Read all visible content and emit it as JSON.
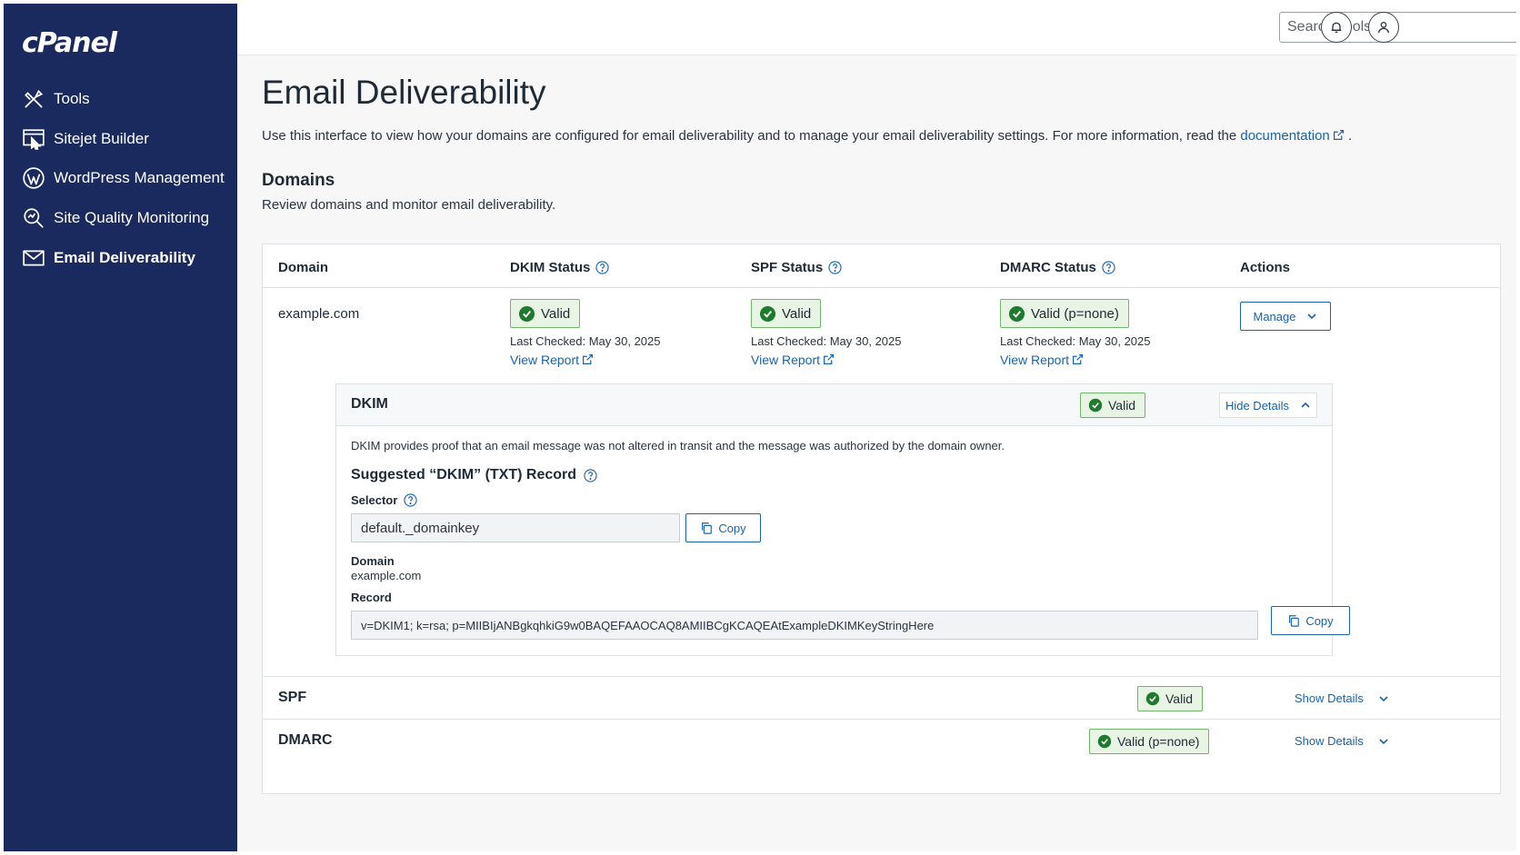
{
  "brand": {
    "logo_text": "cPanel"
  },
  "sidebar": {
    "items": [
      {
        "label": "Tools",
        "icon": "tools-icon"
      },
      {
        "label": "Sitejet Builder",
        "icon": "sitejet-icon"
      },
      {
        "label": "WordPress Management",
        "icon": "wordpress-icon"
      },
      {
        "label": "Site Quality Monitoring",
        "icon": "site-quality-icon"
      },
      {
        "label": "Email Deliverability",
        "icon": "envelope-icon",
        "active": true
      }
    ]
  },
  "topbar": {
    "search_placeholder": "Search Tools (/)"
  },
  "page": {
    "title": "Email Deliverability",
    "intro_text": "Use this interface to view how your domains are configured for email deliverability and to manage your email deliverability settings. For more information, read the",
    "intro_link": "documentation",
    "intro_end": ".",
    "section_title": "Domains",
    "section_subtitle": "Review domains and monitor email deliverability."
  },
  "table": {
    "headers": {
      "domain": "Domain",
      "dkim": "DKIM Status",
      "spf": "SPF Status",
      "dmarc": "DMARC Status",
      "actions": "Actions"
    },
    "row": {
      "domain": "example.com",
      "dkim": {
        "status": "Valid",
        "checked": "Last Checked: May 30, 2025",
        "report": "View Report"
      },
      "spf": {
        "status": "Valid",
        "checked": "Last Checked: May 30, 2025",
        "report": "View Report"
      },
      "dmarc": {
        "status": "Valid (p=none)",
        "checked": "Last Checked: May 30, 2025",
        "report": "View Report"
      },
      "action_label": "Manage"
    }
  },
  "dkim_panel": {
    "title": "DKIM",
    "status": "Valid",
    "toggle_label": "Hide Details",
    "description": "DKIM provides proof that an email message was not altered in transit and the message was authorized by the domain owner.",
    "suggested_title": "Suggested “DKIM” (TXT) Record",
    "selector_label": "Selector",
    "selector_value": "default._domainkey",
    "domain_label": "Domain",
    "domain_value": "example.com",
    "record_label": "Record",
    "record_value": "v=DKIM1; k=rsa; p=MIIBIjANBgkqhkiG9w0BAQEFAAOCAQ8AMIIBCgKCAQEAtExampleDKIMKeyStringHere",
    "copy_label": "Copy"
  },
  "spf_row": {
    "title": "SPF",
    "status": "Valid",
    "toggle_label": "Show Details"
  },
  "dmarc_row": {
    "title": "DMARC",
    "status": "Valid (p=none)",
    "toggle_label": "Show Details"
  },
  "colors": {
    "sidebar_bg": "#1b2a5e",
    "link": "#1a63a8",
    "valid_bg": "#e8f5e4",
    "valid_border": "#6fb66a",
    "valid_icon": "#1e7b2e"
  }
}
